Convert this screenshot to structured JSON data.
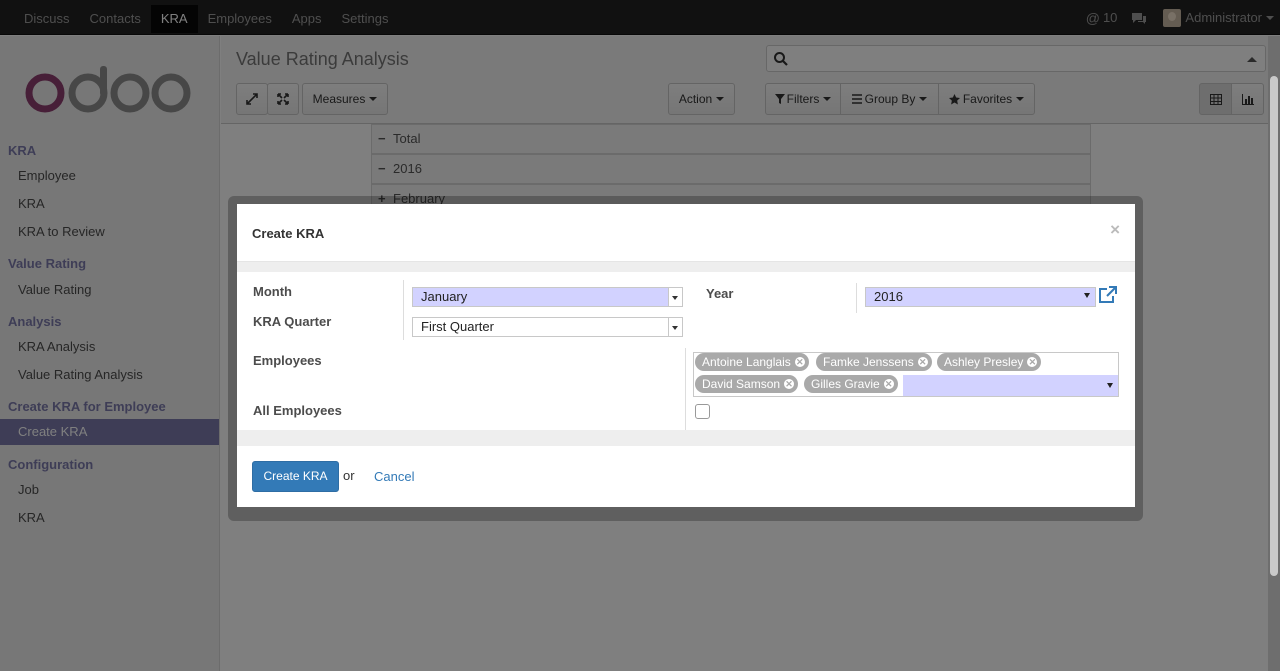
{
  "topnav": {
    "items": [
      {
        "label": "Discuss",
        "active": false
      },
      {
        "label": "Contacts",
        "active": false
      },
      {
        "label": "KRA",
        "active": true
      },
      {
        "label": "Employees",
        "active": false
      },
      {
        "label": "Apps",
        "active": false
      },
      {
        "label": "Settings",
        "active": false
      }
    ],
    "messages_count": "10",
    "user_name": "Administrator"
  },
  "sidebar": {
    "logo_text": "odoo",
    "groups": [
      {
        "label": "KRA",
        "items": [
          "Employee",
          "KRA",
          "KRA to Review"
        ]
      },
      {
        "label": "Value Rating",
        "items": [
          "Value Rating"
        ]
      },
      {
        "label": "Analysis",
        "items": [
          "KRA Analysis",
          "Value Rating Analysis"
        ]
      },
      {
        "label": "Create KRA for Employee",
        "items": [
          "Create KRA"
        ]
      },
      {
        "label": "Configuration",
        "items": [
          "Job",
          "KRA"
        ]
      }
    ],
    "active_item": "Create KRA"
  },
  "header": {
    "title": "Value Rating Analysis",
    "measures_label": "Measures",
    "action_label": "Action",
    "filters_label": "Filters",
    "groupby_label": "Group By",
    "favorites_label": "Favorites"
  },
  "pivot": {
    "rows": [
      {
        "sign": "−",
        "label": "Total"
      },
      {
        "sign": "−",
        "label": "2016"
      },
      {
        "sign": "+",
        "label": "February"
      }
    ]
  },
  "dialog": {
    "title": "Create KRA",
    "close": "×",
    "month_label": "Month",
    "month_value": "January",
    "year_label": "Year",
    "year_value": "2016",
    "quarter_label": "KRA Quarter",
    "quarter_value": "First Quarter",
    "employees_label": "Employees",
    "employees": [
      "Antoine Langlais",
      "Famke Jenssens",
      "Ashley Presley",
      "David Samson",
      "Gilles Gravie"
    ],
    "all_employees_label": "All Employees",
    "all_employees_checked": false,
    "create_label": "Create KRA",
    "or_label": "or",
    "cancel_label": "Cancel"
  },
  "colors": {
    "brand": "#7c7bad",
    "topbar": "#222222",
    "primary": "#337ab7",
    "required_field": "#d2d2ff"
  },
  "icons": [
    "search-icon",
    "expand-icon",
    "fullscreen-icon",
    "filter-icon",
    "list-icon",
    "star-icon",
    "table-view-icon",
    "chart-view-icon",
    "external-link-icon",
    "chat-icon",
    "at-icon"
  ]
}
